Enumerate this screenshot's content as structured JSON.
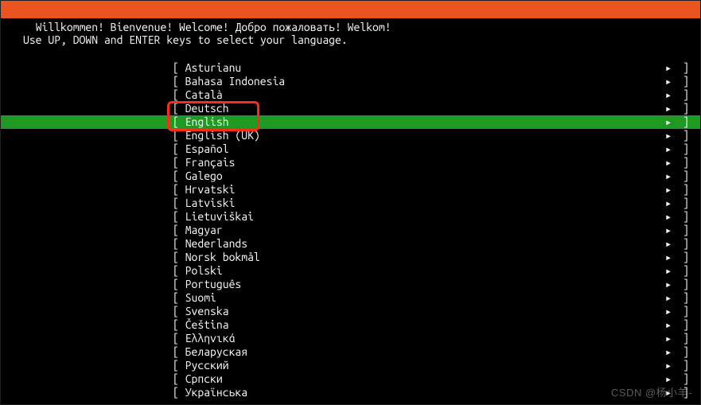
{
  "header": {
    "title": "Willkommen! Bienvenue! Welcome! Добро пожаловать! Welkom!"
  },
  "instruction": "Use UP, DOWN and ENTER keys to select your language.",
  "languages": [
    {
      "label": "Asturianu",
      "selected": false
    },
    {
      "label": "Bahasa Indonesia",
      "selected": false
    },
    {
      "label": "Català",
      "selected": false
    },
    {
      "label": "Deutsch",
      "selected": false
    },
    {
      "label": "English",
      "selected": true
    },
    {
      "label": "English (UK)",
      "selected": false
    },
    {
      "label": "Español",
      "selected": false
    },
    {
      "label": "Français",
      "selected": false
    },
    {
      "label": "Galego",
      "selected": false
    },
    {
      "label": "Hrvatski",
      "selected": false
    },
    {
      "label": "Latviski",
      "selected": false
    },
    {
      "label": "Lietuviškai",
      "selected": false
    },
    {
      "label": "Magyar",
      "selected": false
    },
    {
      "label": "Nederlands",
      "selected": false
    },
    {
      "label": "Norsk bokmål",
      "selected": false
    },
    {
      "label": "Polski",
      "selected": false
    },
    {
      "label": "Português",
      "selected": false
    },
    {
      "label": "Suomi",
      "selected": false
    },
    {
      "label": "Svenska",
      "selected": false
    },
    {
      "label": "Čeština",
      "selected": false
    },
    {
      "label": "Ελληνικά",
      "selected": false
    },
    {
      "label": "Беларуская",
      "selected": false
    },
    {
      "label": "Русский",
      "selected": false
    },
    {
      "label": "Српски",
      "selected": false
    },
    {
      "label": "Українська",
      "selected": false
    }
  ],
  "glyphs": {
    "bracket_open": "[ ",
    "bracket_close": " ]",
    "chevron": "▸"
  },
  "annotation": {
    "highlight_target_index": 4
  },
  "watermark": "CSDN @杨小羊-"
}
